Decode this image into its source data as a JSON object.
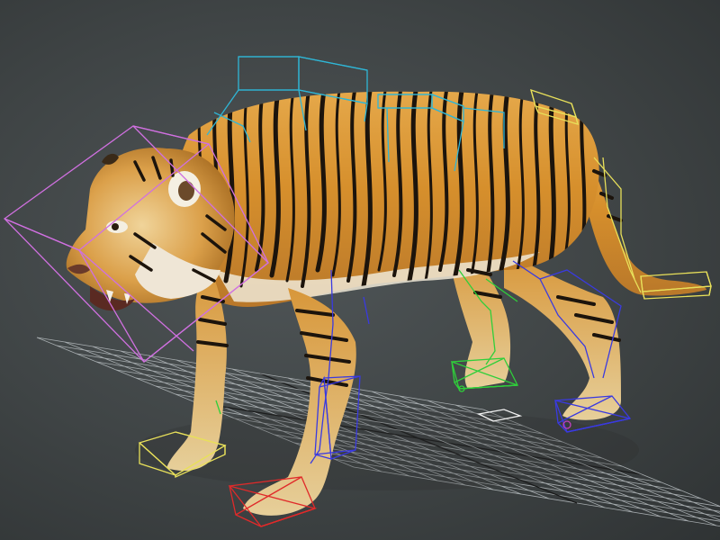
{
  "viewport": {
    "background": "#474c4d",
    "grid_color": "#b9bfc2",
    "grid_axis_color": "#151515"
  },
  "model": {
    "subject": "tiger",
    "fur_base": "#d89a35",
    "fur_light": "#f0c96a",
    "stripe": "#1c140c",
    "belly": "#e8e2d4"
  },
  "rig": {
    "colors": {
      "head": "#d070e0",
      "spine": "#2fb6d6",
      "tail": "#e8e05a",
      "front_left": "#e8e05a",
      "front_right": "#e02a2a",
      "right_leg": "#3a3ae0",
      "left_hind": "#2fcf3a",
      "right_hind": "#3a3ae0",
      "pivot": "#c040c0"
    }
  }
}
